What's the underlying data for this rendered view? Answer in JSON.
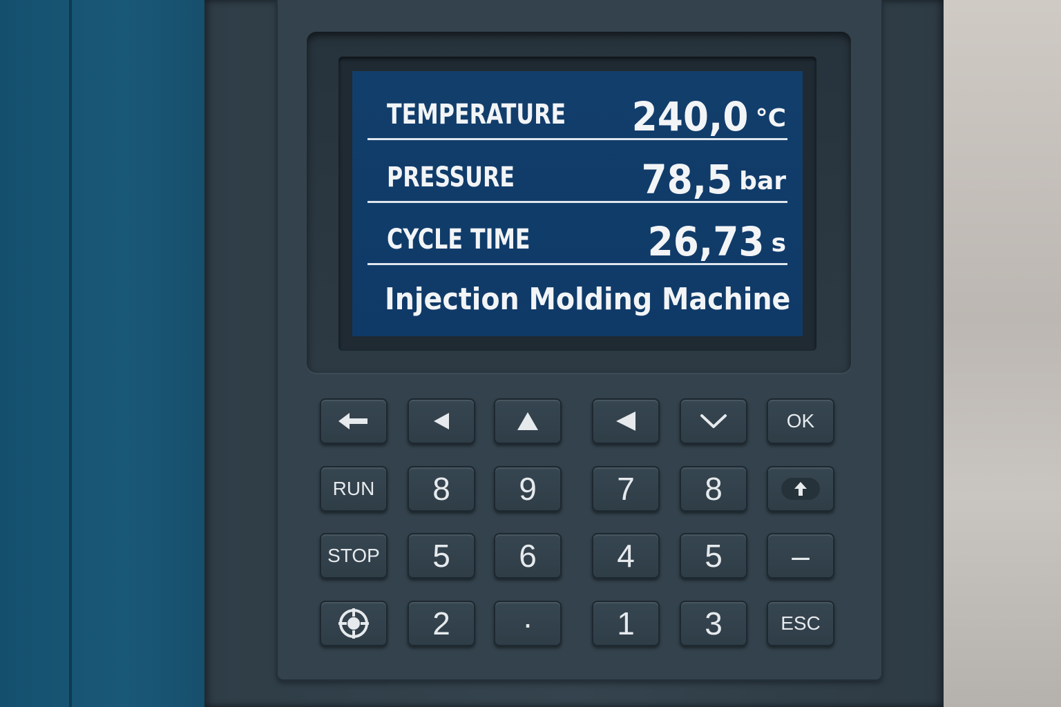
{
  "display": {
    "rows": [
      {
        "label": "TEMPERATURE",
        "value": "240,0",
        "unit": "°C"
      },
      {
        "label": "PRESSURE",
        "value": "78,5",
        "unit": "bar"
      },
      {
        "label": "CYCLE TIME",
        "value": "26,73",
        "unit": "s"
      }
    ],
    "footer": "Injection Molding Machine"
  },
  "keypad": {
    "row1": [
      {
        "icon": "back-arrow-icon"
      },
      {
        "icon": "left-triangle-icon"
      },
      {
        "icon": "up-triangle-icon"
      },
      {
        "icon": "left-triangle-icon"
      },
      {
        "icon": "chevron-down-icon"
      },
      {
        "label": "OK"
      }
    ],
    "row2": [
      {
        "label": "RUN"
      },
      {
        "label": "8"
      },
      {
        "label": "9"
      },
      {
        "label": "7"
      },
      {
        "label": "8"
      },
      {
        "icon": "up-arrow-icon"
      }
    ],
    "row3": [
      {
        "label": "STOP"
      },
      {
        "label": "5"
      },
      {
        "label": "6"
      },
      {
        "label": "4"
      },
      {
        "label": "5"
      },
      {
        "label": "–"
      }
    ],
    "row4": [
      {
        "icon": "target-icon"
      },
      {
        "label": "2"
      },
      {
        "label": "·"
      },
      {
        "label": "1"
      },
      {
        "label": "3"
      },
      {
        "label": "ESC"
      }
    ]
  },
  "colors": {
    "screen": "#0f3a68",
    "panel": "#33424c",
    "key": "#32414b",
    "text": "#f2f4f6"
  }
}
